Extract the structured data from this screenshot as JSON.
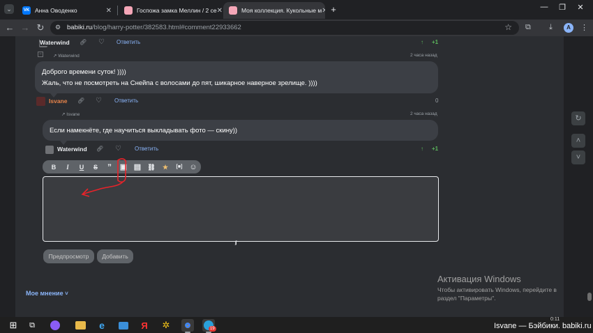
{
  "browser": {
    "tabs": [
      {
        "title": "Анна Оводенко",
        "favicon_color": "#0077ff",
        "favicon_text": "VK",
        "active": false
      },
      {
        "title": "Госпожа замка Меллин / 2 се",
        "favicon_color": "#f4a6b7",
        "favicon_text": "",
        "active": false
      },
      {
        "title": "Моя коллекция. Кукольные м",
        "favicon_color": "#f4a6b7",
        "favicon_text": "",
        "active": true
      }
    ],
    "new_tab_label": "+",
    "url_host": "babiki.ru",
    "url_path": "/blog/harry-potter/382583.html#comment22933662",
    "profile_initial": "A"
  },
  "comments": [
    {
      "author": "Waterwind",
      "reply_label": "Ответить",
      "votes": "+1"
    },
    {
      "reply_to": "Waterwind",
      "time": "2 часа назад",
      "lines": [
        "Доброго времени суток! ))))",
        "Жаль, что не посмотреть на Снейпа с волосами до пят, шикарное наверное зрелище. ))))"
      ],
      "author": "Isvane",
      "reply_label": "Ответить",
      "votes": "0"
    },
    {
      "reply_to": "Isvane",
      "time": "2 часа назад",
      "lines": [
        "Если намекнёте, где научиться выкладывать фото — скину))"
      ],
      "author": "Waterwind",
      "reply_label": "Ответить",
      "votes": "+1"
    }
  ],
  "editor": {
    "tools": [
      {
        "label": "B",
        "icon": "bold-icon"
      },
      {
        "label": "I",
        "icon": "italic-icon"
      },
      {
        "label": "U",
        "icon": "underline-icon"
      },
      {
        "label": "S",
        "icon": "strike-icon"
      },
      {
        "label": "”",
        "icon": "quote-icon"
      },
      {
        "label": "▣",
        "icon": "image-icon"
      },
      {
        "label": "▤",
        "icon": "spoiler-icon"
      },
      {
        "label": "⛓",
        "icon": "link-icon"
      },
      {
        "label": "★",
        "icon": "upload-photo-icon"
      },
      {
        "label": "[■]",
        "icon": "embed-icon"
      },
      {
        "label": "☺",
        "icon": "smiley-icon"
      }
    ],
    "preview_label": "Предпросмотр",
    "submit_label": "Добавить"
  },
  "more_opinion": "Мое мнение",
  "more_chevron": "˅",
  "windows_activation": {
    "title": "Активация Windows",
    "body": "Чтобы активировать Windows, перейдите в раздел \"Параметры\"."
  },
  "taskbar": {
    "tray_time": "0:11",
    "tray_caption": "Isvane — Бэйбики. babiki.ru",
    "chrome_badge": "19"
  },
  "colors": {
    "accent_link": "#8ab4f8",
    "vote_positive": "#5cb85c",
    "annotation_red": "#e8232a",
    "orange_username": "#e8844a"
  }
}
